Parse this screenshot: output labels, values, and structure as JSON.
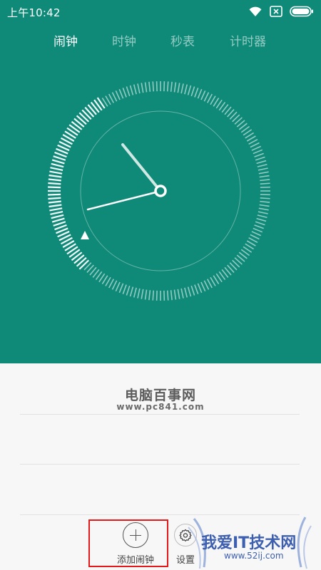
{
  "status_bar": {
    "time": "上午10:42"
  },
  "tabs": [
    {
      "label": "闹钟",
      "active": true
    },
    {
      "label": "时钟",
      "active": false
    },
    {
      "label": "秒表",
      "active": false
    },
    {
      "label": "计时器",
      "active": false
    }
  ],
  "watermark": {
    "title": "电脑百事网",
    "url": "www.pc841.com"
  },
  "bottom_bar": {
    "add_label": "添加闹钟",
    "settings_label": "设置"
  },
  "corner_logo": {
    "title": "我爱IT技术网",
    "url": "www.52ij.com"
  },
  "colors": {
    "header_bg": "#0f8a78",
    "highlight_box": "#e41a1a"
  },
  "icons": {
    "wifi": "wifi-icon",
    "no_sim": "no-sim-icon",
    "battery": "battery-icon",
    "plus": "plus-icon",
    "gear": "gear-icon"
  }
}
